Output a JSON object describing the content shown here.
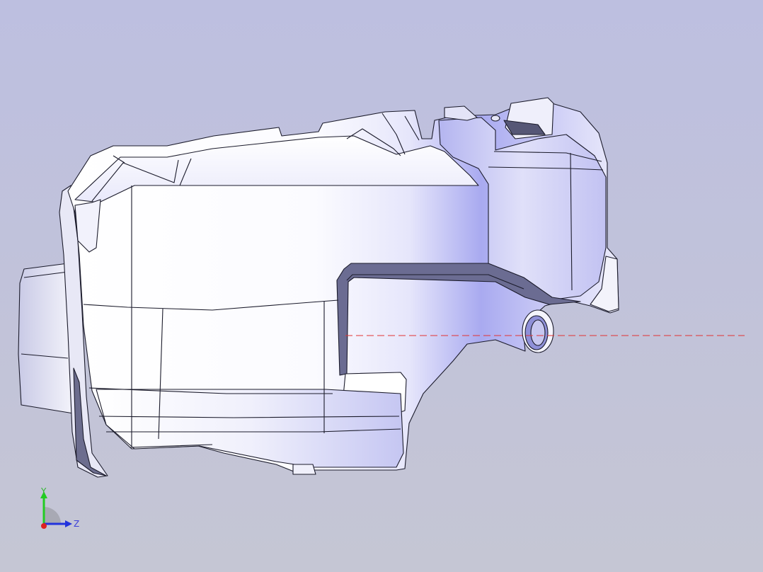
{
  "viewport": {
    "background_top": "#bfc1e0",
    "background_bottom": "#c4c6d6",
    "part_color": "#d7d8f6",
    "part_highlight": "#ffffff",
    "part_shade": "#8f90e6",
    "edge_color": "#1a1a2a",
    "centerline_color": "#e23333"
  },
  "triad": {
    "y_label": "Y",
    "z_label": "Z",
    "y_color": "#22cc22",
    "z_color": "#2233dd",
    "origin_color": "#dd2222"
  }
}
